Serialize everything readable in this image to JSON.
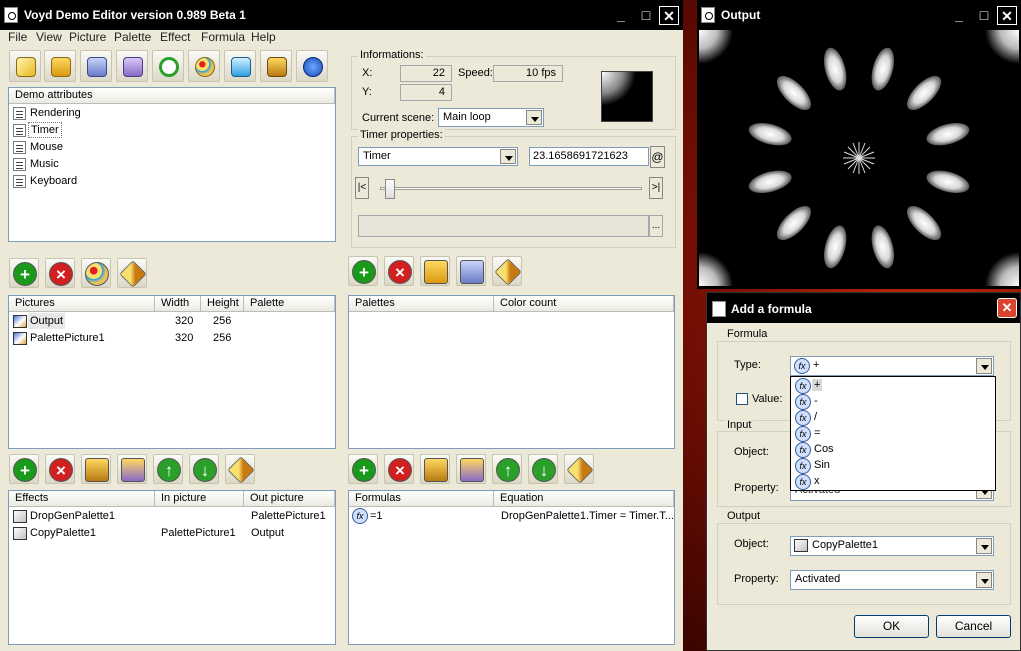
{
  "main_window": {
    "title": "Voyd Demo Editor version 0.989 Beta 1",
    "menu": [
      "File",
      "View",
      "Picture",
      "Palette",
      "Effect",
      "Formula",
      "Help"
    ],
    "demo_attributes": {
      "header": "Demo attributes",
      "items": [
        "Rendering",
        "Timer",
        "Mouse",
        "Music",
        "Keyboard"
      ]
    },
    "informations": {
      "group_label": "Informations:",
      "x_label": "X:",
      "x_value": "22",
      "y_label": "Y:",
      "y_value": "4",
      "speed_label": "Speed:",
      "speed_value": "10 fps",
      "scene_label": "Current scene:",
      "scene_value": "Main loop"
    },
    "timer": {
      "group_label": "Timer properties:",
      "type_value": "Timer",
      "value": "23.1658691721623",
      "at_button": "@",
      "slider_left": "|<",
      "slider_right": ">|",
      "browse_button": "...",
      "slider_level": 0.02
    },
    "pictures": {
      "columns": [
        "Pictures",
        "Width",
        "Height",
        "Palette"
      ],
      "rows": [
        {
          "name": "Output",
          "width": "320",
          "height": "256",
          "palette": ""
        },
        {
          "name": "PalettePicture1",
          "width": "320",
          "height": "256",
          "palette": ""
        }
      ]
    },
    "palettes": {
      "columns": [
        "Palettes",
        "Color count"
      ]
    },
    "effects": {
      "columns": [
        "Effects",
        "In picture",
        "Out picture"
      ],
      "rows": [
        {
          "name": "DropGenPalette1",
          "in": "",
          "out": "PalettePicture1"
        },
        {
          "name": "CopyPalette1",
          "in": "PalettePicture1",
          "out": "Output"
        }
      ]
    },
    "formulas": {
      "columns": [
        "Formulas",
        "Equation"
      ],
      "rows": [
        {
          "name": "=1",
          "equation": "DropGenPalette1.Timer = Timer.T..."
        }
      ]
    }
  },
  "output_window": {
    "title": "Output"
  },
  "formula_dialog": {
    "title": "Add a formula",
    "formula_group": "Formula",
    "type_label": "Type:",
    "type_value": "+",
    "dropdown_options": [
      "+",
      "-",
      "/",
      "=",
      "Cos",
      "Sin",
      "x"
    ],
    "value_label": "Value:",
    "input_group": "Input",
    "input_object_label": "Object:",
    "input_property_label": "Property:",
    "input_property_value": "Activated",
    "output_group": "Output",
    "output_object_label": "Object:",
    "output_object_value": "CopyPalette1",
    "output_property_label": "Property:",
    "output_property_value": "Activated",
    "ok": "OK",
    "cancel": "Cancel"
  },
  "window_buttons": {
    "minimize": "_",
    "maximize": "□",
    "close": "✕"
  },
  "colors": {
    "accent": "#316ac5",
    "dialog_close": "#d8442c",
    "add": "#1a9a1a",
    "delete": "#d22020",
    "up_down": "#2aa02a"
  },
  "icons": [
    "new-icon",
    "open-icon",
    "save-icon",
    "save-as-icon",
    "refresh-icon",
    "palette-icon",
    "render-icon",
    "picture-icon",
    "info-icon",
    "add-icon",
    "delete-icon",
    "edit-icon",
    "move-up-icon",
    "move-down-icon",
    "formula-icon"
  ]
}
